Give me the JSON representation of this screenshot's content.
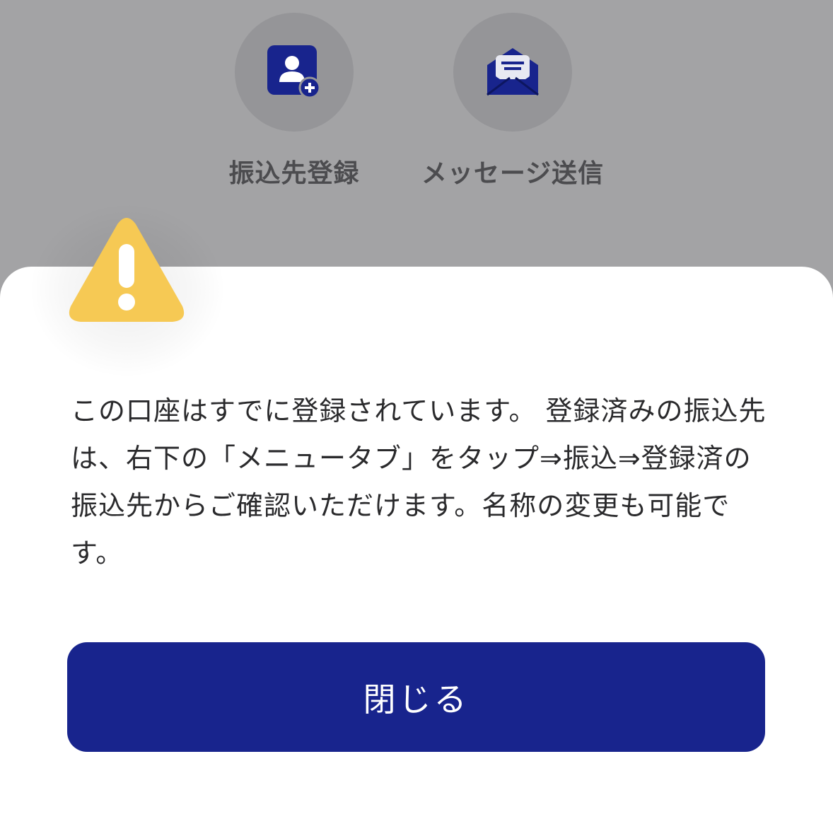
{
  "background_actions": [
    {
      "label": "振込先登録",
      "icon": "person-add-icon"
    },
    {
      "label": "メッセージ送信",
      "icon": "envelope-message-icon"
    }
  ],
  "dialog": {
    "icon": "warning-icon",
    "message": "この口座はすでに登録されています。 登録済みの振込先は、右下の「メニュータブ」をタップ⇒振込⇒登録済の振込先からご確認いただけます。名称の変更も可能です。",
    "close_label": "閉じる"
  },
  "colors": {
    "overlay": "#a3a3a5",
    "primary": "#18248d",
    "warning": "#f6c954"
  }
}
